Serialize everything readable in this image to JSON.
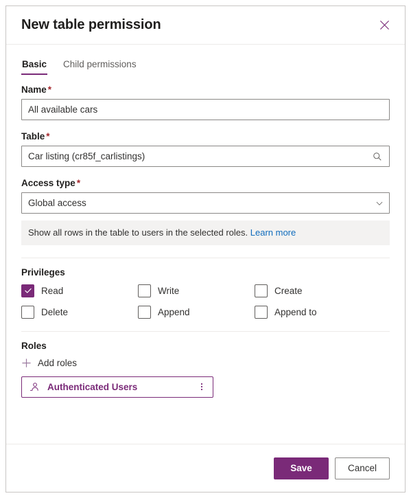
{
  "dialog": {
    "title": "New table permission",
    "close_icon": "close-icon"
  },
  "tabs": [
    {
      "label": "Basic",
      "active": true
    },
    {
      "label": "Child permissions",
      "active": false
    }
  ],
  "fields": {
    "name": {
      "label": "Name",
      "required_marker": "*",
      "value": "All available cars",
      "placeholder": ""
    },
    "table": {
      "label": "Table",
      "required_marker": "*",
      "value": "Car listing (cr85f_carlistings)",
      "placeholder": "",
      "icon": "search-icon"
    },
    "access_type": {
      "label": "Access type",
      "required_marker": "*",
      "value": "Global access",
      "icon": "chevron-down-icon",
      "help_text": "Show all rows in the table to users in the selected roles.",
      "help_link_text": "Learn more"
    }
  },
  "privileges": {
    "title": "Privileges",
    "items": [
      {
        "label": "Read",
        "checked": true
      },
      {
        "label": "Write",
        "checked": false
      },
      {
        "label": "Create",
        "checked": false
      },
      {
        "label": "Delete",
        "checked": false
      },
      {
        "label": "Append",
        "checked": false
      },
      {
        "label": "Append to",
        "checked": false
      }
    ]
  },
  "roles": {
    "title": "Roles",
    "add_label": "Add roles",
    "add_icon": "plus-icon",
    "chips": [
      {
        "name": "Authenticated Users",
        "icon": "person-icon",
        "more_icon": "more-vertical-icon"
      }
    ]
  },
  "footer": {
    "save_label": "Save",
    "cancel_label": "Cancel"
  },
  "colors": {
    "accent": "#7a2a78",
    "required": "#a4262c",
    "link": "#0f6cbd",
    "banner_bg": "#f3f2f1",
    "border": "#8a8886",
    "divider": "#edebe9"
  }
}
